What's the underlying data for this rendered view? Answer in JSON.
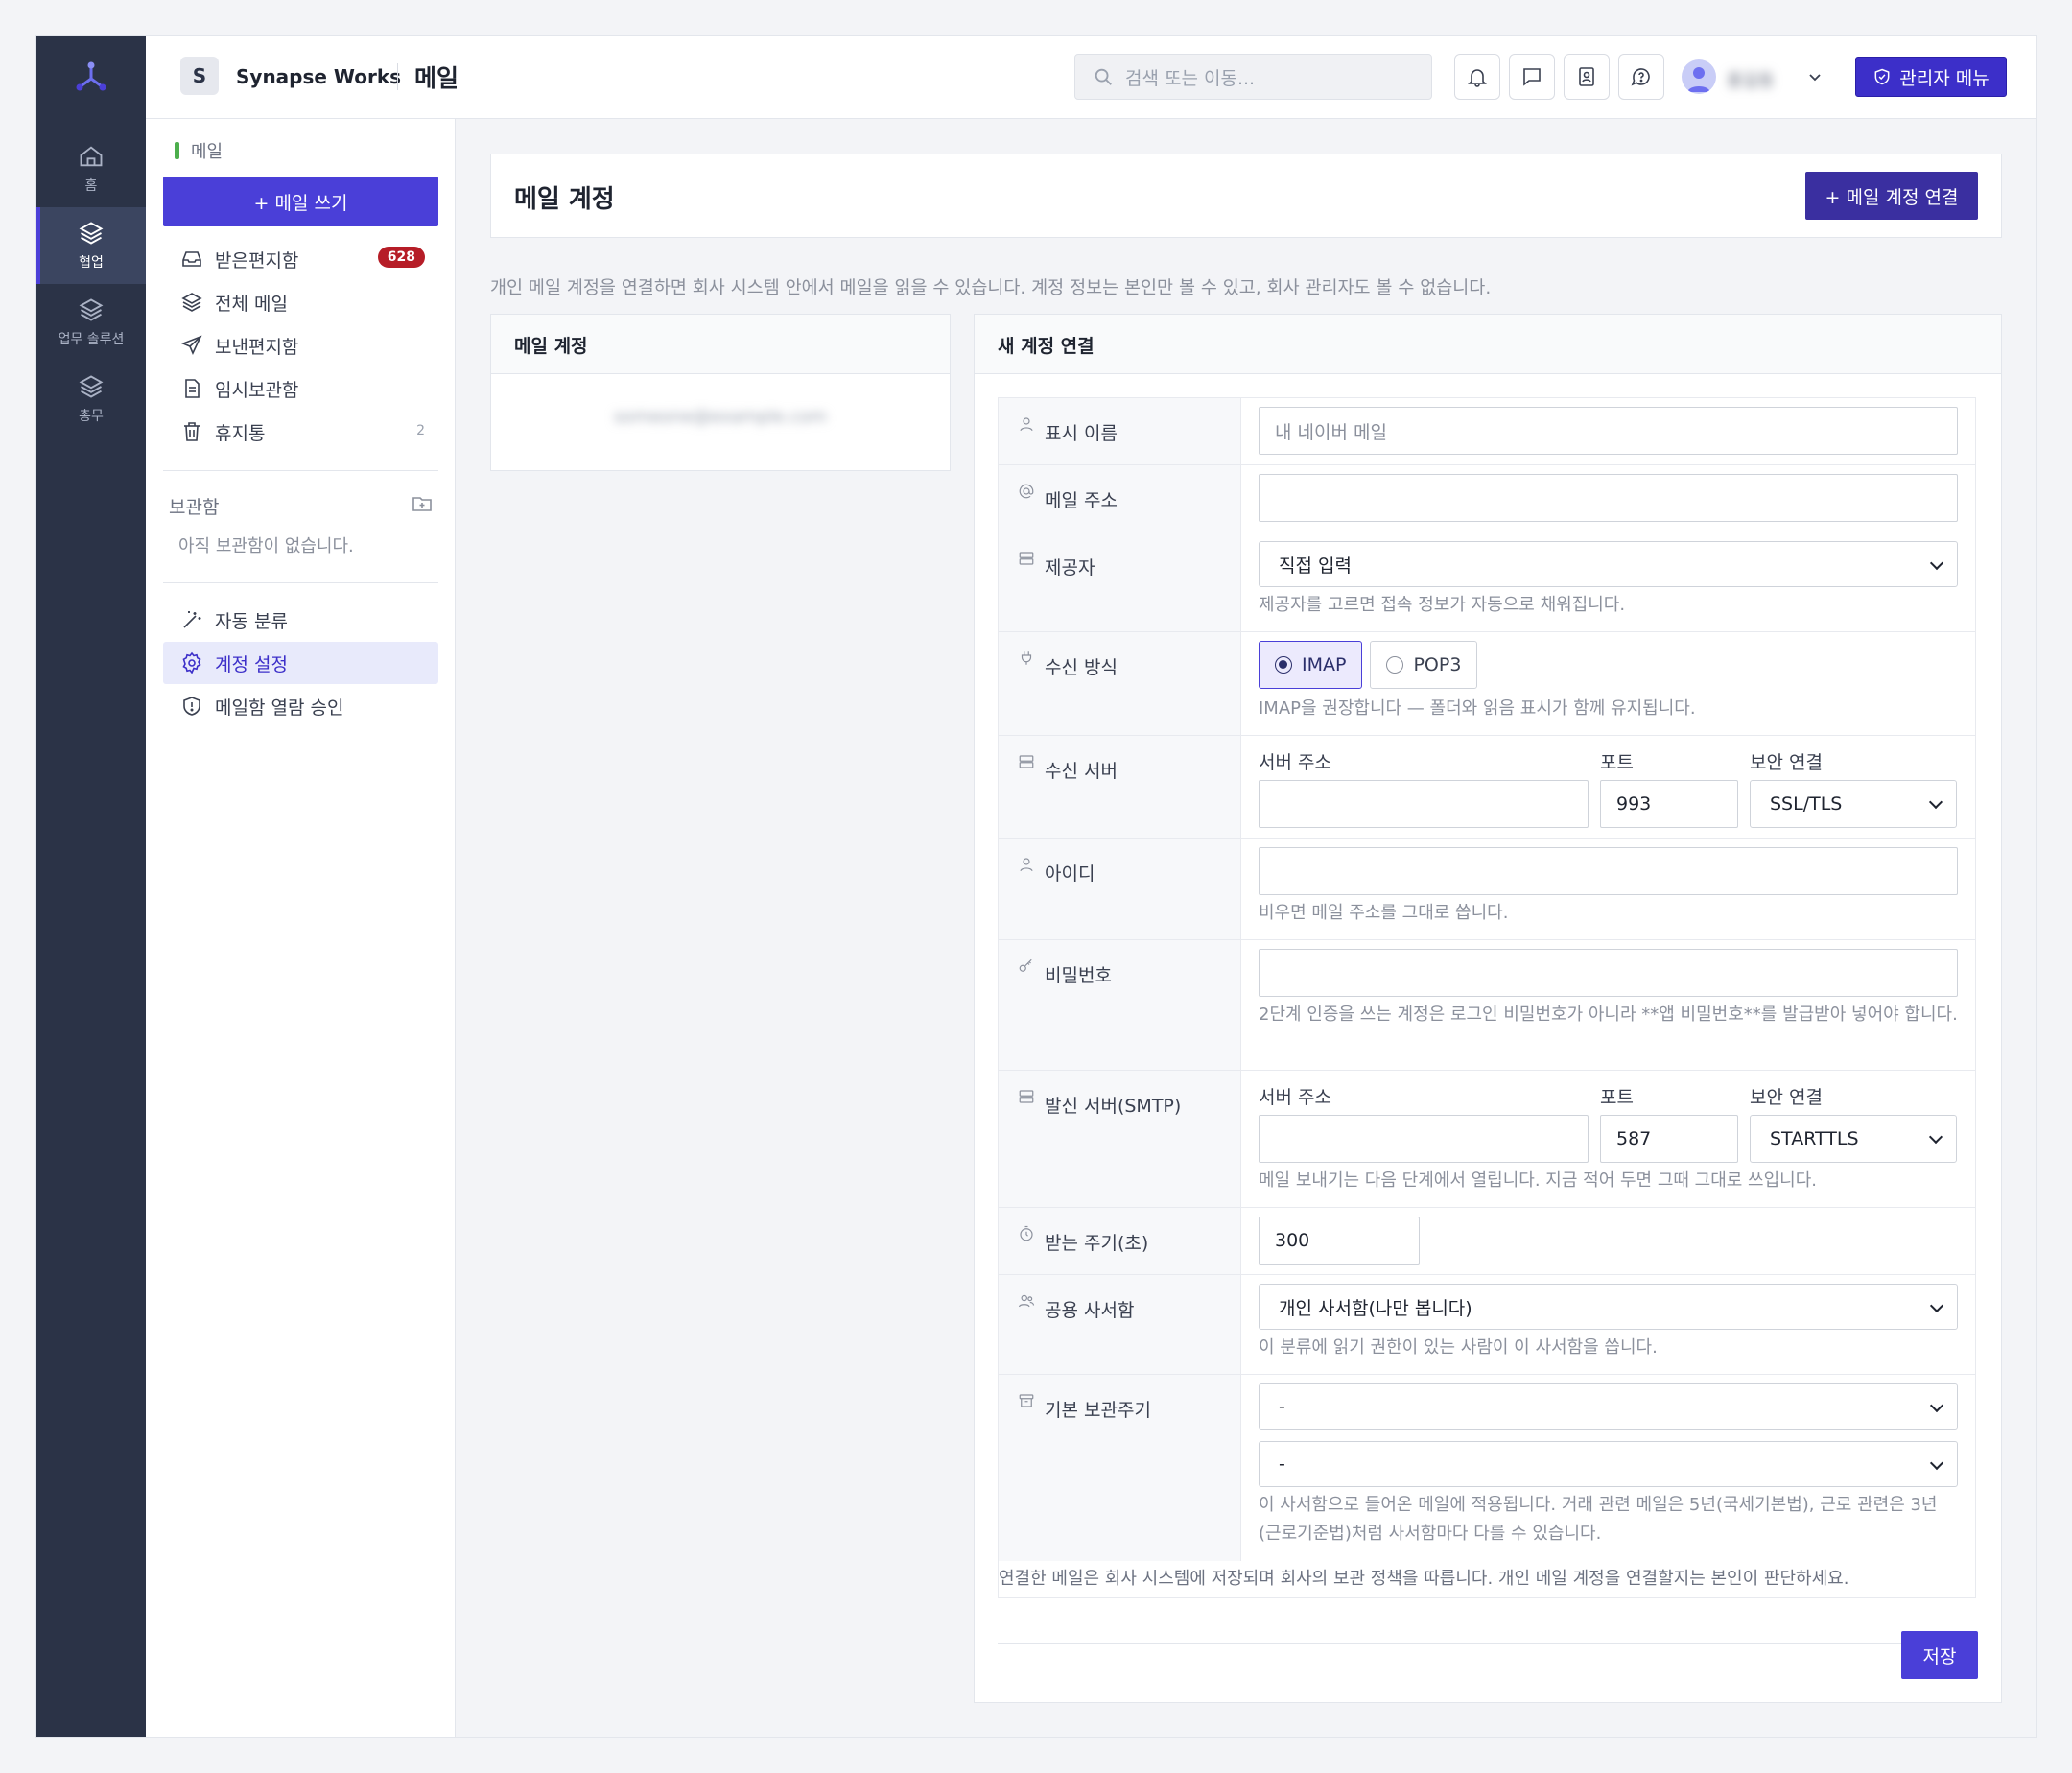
{
  "rail": {
    "items": [
      {
        "label": "홈",
        "icon": "home-icon"
      },
      {
        "label": "협업",
        "icon": "layers-icon"
      },
      {
        "label": "업무 솔루션",
        "icon": "layers-icon"
      },
      {
        "label": "총무",
        "icon": "layers-icon"
      }
    ]
  },
  "header": {
    "workspace_badge": "S",
    "workspace_name": "Synapse Works",
    "page": "메일",
    "search_placeholder": "검색 또는 이동...",
    "user_name": "홍길동",
    "admin_button": "관리자 메뉴"
  },
  "sidebar": {
    "section": "메일",
    "compose": "+ 메일 쓰기",
    "folders": [
      {
        "label": "받은편지함",
        "icon": "inbox-icon",
        "badge": "628"
      },
      {
        "label": "전체 메일",
        "icon": "layers-icon"
      },
      {
        "label": "보낸편지함",
        "icon": "send-icon"
      },
      {
        "label": "임시보관함",
        "icon": "draft-icon"
      },
      {
        "label": "휴지통",
        "icon": "trash-icon",
        "count": "2"
      }
    ],
    "archive_heading": "보관함",
    "archive_empty": "아직 보관함이 없습니다.",
    "tools": [
      {
        "label": "자동 분류",
        "icon": "magic-wand-icon"
      },
      {
        "label": "계정 설정",
        "icon": "gear-icon"
      },
      {
        "label": "메일함 열람 승인",
        "icon": "shield-icon"
      }
    ]
  },
  "main": {
    "title": "메일 계정",
    "connect_button": "+ 메일 계정 연결",
    "description": "개인 메일 계정을 연결하면 회사 시스템 안에서 메일을 읽을 수 있습니다. 계정 정보는 본인만 볼 수 있고, 회사 관리자도 볼 수 없습니다.",
    "accounts_heading": "메일 계정",
    "account_email": "someone@example.com",
    "form_heading": "새 계정 연결",
    "fields": {
      "display_name": {
        "label": "표시 이름",
        "value": "내 네이버 메일"
      },
      "email": {
        "label": "메일 주소",
        "value": ""
      },
      "provider": {
        "label": "제공자",
        "value": "직접 입력",
        "hint": "제공자를 고르면 접속 정보가 자동으로 채워집니다."
      },
      "protocol": {
        "label": "수신 방식",
        "options": [
          "IMAP",
          "POP3"
        ],
        "selected": "IMAP",
        "hint": "IMAP을 권장합니다 — 폴더와 읽음 표시가 함께 유지됩니다."
      },
      "incoming": {
        "label": "수신 서버",
        "host_label": "서버 주소",
        "port_label": "포트",
        "security_label": "보안 연결",
        "host": "",
        "port": "993",
        "security": "SSL/TLS"
      },
      "username": {
        "label": "아이디",
        "value": "",
        "hint": "비우면 메일 주소를 그대로 씁니다."
      },
      "password": {
        "label": "비밀번호",
        "value": "",
        "hint": "2단계 인증을 쓰는 계정은 로그인 비밀번호가 아니라 **앱 비밀번호**를 발급받아 넣어야 합니다."
      },
      "outgoing": {
        "label": "발신 서버(SMTP)",
        "host_label": "서버 주소",
        "port_label": "포트",
        "security_label": "보안 연결",
        "host": "",
        "port": "587",
        "security": "STARTTLS",
        "hint": "메일 보내기는 다음 단계에서 열립니다. 지금 적어 두면 그때 그대로 쓰입니다."
      },
      "interval": {
        "label": "받는 주기(초)",
        "value": "300"
      },
      "shared_mailbox": {
        "label": "공용 사서함",
        "value": "개인 사서함(나만 봅니다)",
        "hint": "이 분류에 읽기 권한이 있는 사람이 이 사서함을 씁니다."
      },
      "retention": {
        "label": "기본 보관주기",
        "value1": "-",
        "value2": "-",
        "hint": "이 사서함으로 들어온 메일에 적용됩니다. 거래 관련 메일은 5년(국세기본법), 근로 관련은 3년(근로기준법)처럼 사서함마다 다를 수 있습니다."
      }
    },
    "footnote": "연결한 메일은 회사 시스템에 저장되며 회사의 보관 정책을 따릅니다. 개인 메일 계정을 연결할지는 본인이 판단하세요.",
    "save_button": "저장"
  }
}
